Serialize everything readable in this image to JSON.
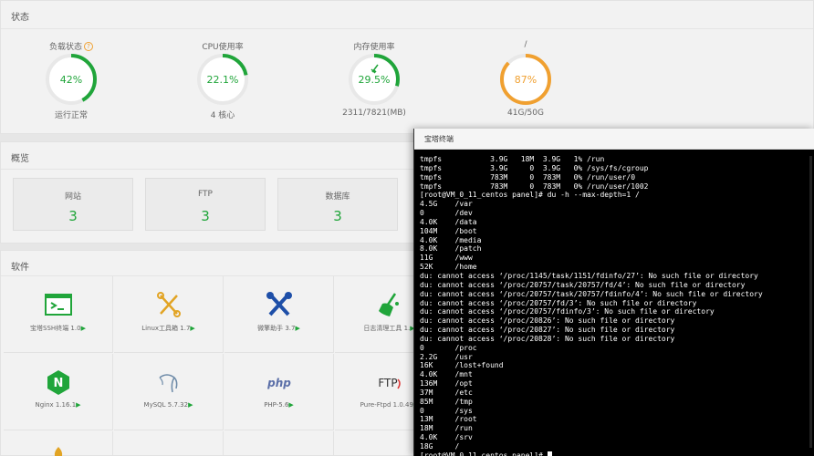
{
  "status": {
    "title": "状态",
    "gauges": [
      {
        "label": "负载状态",
        "value": "42%",
        "percent": 42,
        "sub": "运行正常",
        "color": "#20a53a",
        "has_help": true
      },
      {
        "label": "CPU使用率",
        "value": "22.1%",
        "percent": 22.1,
        "sub": "4 核心",
        "color": "#20a53a",
        "has_help": false
      },
      {
        "label": "内存使用率",
        "value": "29.5%",
        "percent": 29.5,
        "sub": "2311/7821(MB)",
        "color": "#20a53a",
        "has_help": false,
        "has_rocket": true
      },
      {
        "label": "/",
        "value": "87%",
        "percent": 87,
        "sub": "41G/50G",
        "color": "#f0a030",
        "has_help": false
      }
    ],
    "help_glyph": "?"
  },
  "overview": {
    "title": "概览",
    "items": [
      {
        "label": "网站",
        "value": "3"
      },
      {
        "label": "FTP",
        "value": "3"
      },
      {
        "label": "数据库",
        "value": "3"
      }
    ]
  },
  "software": {
    "title": "软件",
    "arrow_glyph": "▶",
    "items": [
      {
        "name": "宝塔SSH终端 1.0",
        "icon": "terminal-icon"
      },
      {
        "name": "Linux工具箱 1.7",
        "icon": "toolbox-icon"
      },
      {
        "name": "微擎助手 3.7",
        "icon": "wrench-icon"
      },
      {
        "name": "日志清理工具 1.",
        "icon": "broom-icon"
      },
      {
        "name": "Nginx 1.16.1",
        "icon": "nginx-icon"
      },
      {
        "name": "MySQL 5.7.32",
        "icon": "mysql-icon"
      },
      {
        "name": "PHP-5.6",
        "icon": "php-icon"
      },
      {
        "name": "Pure-Ftpd 1.0.49",
        "icon": "ftp-icon"
      }
    ],
    "php_text": "php",
    "ftp_text": "FTP",
    "nginx_text": "N"
  },
  "terminal": {
    "title": "宝塔终端",
    "lines": [
      "tmpfs           3.9G   18M  3.9G   1% /run",
      "tmpfs           3.9G     0  3.9G   0% /sys/fs/cgroup",
      "tmpfs           783M     0  783M   0% /run/user/0",
      "tmpfs           783M     0  783M   0% /run/user/1002",
      "[root@VM_0_11_centos panel]# du -h --max-depth=1 /",
      "4.5G    /var",
      "0       /dev",
      "4.0K    /data",
      "104M    /boot",
      "4.0K    /media",
      "8.0K    /patch",
      "11G     /www",
      "52K     /home",
      "du: cannot access ‘/proc/1145/task/1151/fdinfo/27’: No such file or directory",
      "du: cannot access ‘/proc/20757/task/20757/fd/4’: No such file or directory",
      "du: cannot access ‘/proc/20757/task/20757/fdinfo/4’: No such file or directory",
      "du: cannot access ‘/proc/20757/fd/3’: No such file or directory",
      "du: cannot access ‘/proc/20757/fdinfo/3’: No such file or directory",
      "du: cannot access ‘/proc/20826’: No such file or directory",
      "du: cannot access ‘/proc/20827’: No such file or directory",
      "du: cannot access ‘/proc/20828’: No such file or directory",
      "0       /proc",
      "2.2G    /usr",
      "16K     /lost+found",
      "4.0K    /mnt",
      "136M    /opt",
      "37M     /etc",
      "85M     /tmp",
      "0       /sys",
      "13M     /root",
      "18M     /run",
      "4.0K    /srv",
      "18G     /"
    ],
    "prompt": "[root@VM_0_11_centos panel]# "
  },
  "colors": {
    "accent": "#20a53a",
    "warning": "#f0a030",
    "track": "#e8e8e8"
  }
}
